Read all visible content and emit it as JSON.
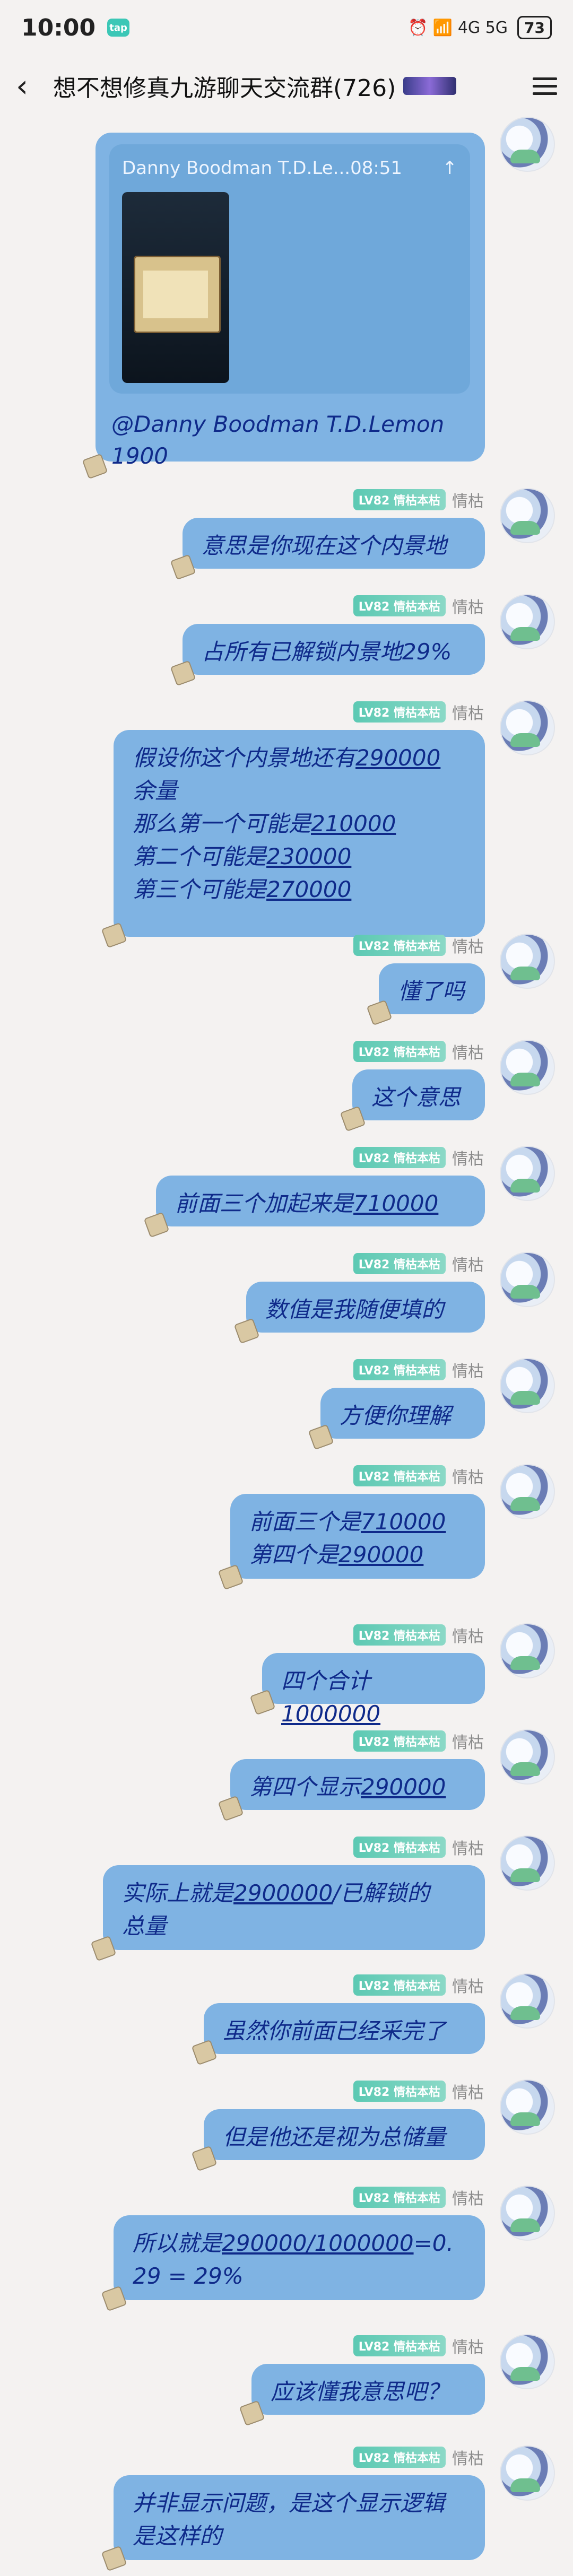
{
  "statusbar": {
    "time": "10:00",
    "tap_badge": "tap",
    "signal_text": "⏰ 📶 4G 5G",
    "battery": "73"
  },
  "navbar": {
    "back_icon": "chevron-left-icon",
    "title": "想不想修真九游聊天交流群(726)",
    "menu_icon": "hamburger-menu-icon"
  },
  "quoted_message": {
    "header": "Danny Boodman T.D.Le...08:51",
    "pin_icon": "↑",
    "mention": "@Danny Boodman T.D.Lemon 1900"
  },
  "sender": {
    "level_tag": "LV82 情枯本枯",
    "name": "情枯"
  },
  "messages": [
    {
      "text": "意思是你现在这个内景地"
    },
    {
      "text": "占所有已解锁内景地29%"
    },
    {
      "lines": [
        "假设你这个内景地还有290000",
        "余量",
        "那么第一个可能是210000",
        "第二个可能是230000",
        "第三个可能是270000"
      ]
    },
    {
      "text": "懂了吗"
    },
    {
      "text": "这个意思"
    },
    {
      "text": "前面三个加起来是710000"
    },
    {
      "text": "数值是我随便填的"
    },
    {
      "text": "方便你理解"
    },
    {
      "lines": [
        "前面三个是710000",
        "第四个是290000"
      ]
    },
    {
      "text": "四个合计1000000"
    },
    {
      "text": "第四个显示290000"
    },
    {
      "lines": [
        "实际上就是2900000/已解锁的",
        "总量"
      ]
    },
    {
      "text": "虽然你前面已经采完了"
    },
    {
      "text": "但是他还是视为总储量"
    },
    {
      "lines": [
        "所以就是290000/1000000=0.",
        "29 = 29%"
      ]
    },
    {
      "text": "应该懂我意思吧？"
    },
    {
      "lines": [
        "并非显示问题，是这个显示逻辑",
        "是这样的"
      ]
    }
  ]
}
